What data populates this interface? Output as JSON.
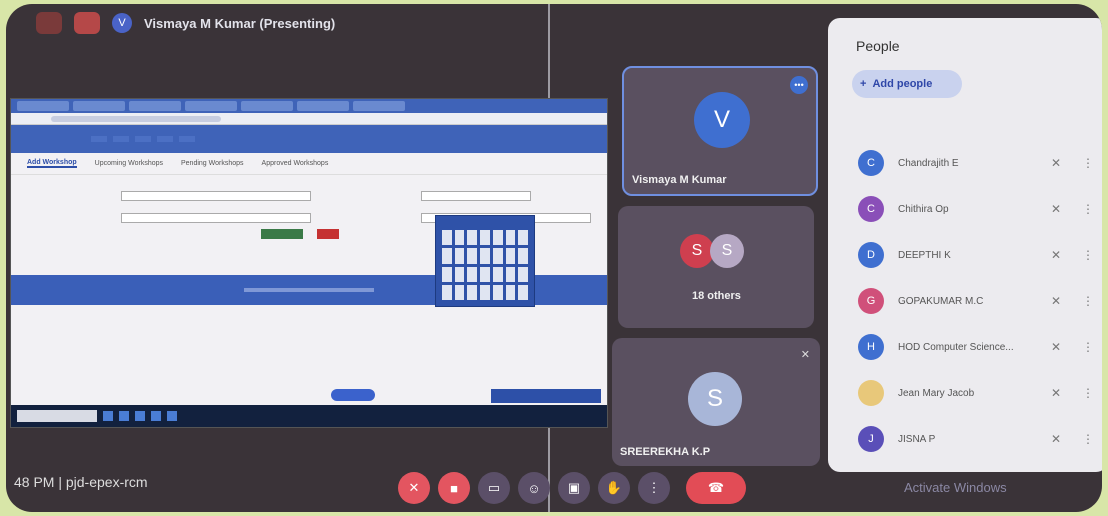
{
  "topbar": {
    "presenter_initial": "V",
    "presenter_text": "Vismaya M Kumar (Presenting)"
  },
  "shared_screen": {
    "sub_tabs": [
      "Add Workshop",
      "Upcoming Workshops",
      "Pending Workshops",
      "Approved Workshops"
    ]
  },
  "tiles": [
    {
      "initial": "V",
      "name": "Vismaya M Kumar",
      "color": "#3f6fd0"
    },
    {
      "initials": [
        "S",
        "S"
      ],
      "name": "18 others",
      "colors": [
        "#cf3f4f",
        "#b6a8c4"
      ]
    },
    {
      "initial": "S",
      "name": "SREEREKHA K.P",
      "color": "#a8b6d8"
    }
  ],
  "people": {
    "title": "People",
    "add_label": "Add people",
    "members": [
      {
        "initial": "C",
        "name": "Chandrajith E",
        "color": "#3f6fd0"
      },
      {
        "initial": "C",
        "name": "Chithira Op",
        "color": "#8a4fb8"
      },
      {
        "initial": "D",
        "name": "DEEPTHI K",
        "color": "#3f6fd0"
      },
      {
        "initial": "G",
        "name": "GOPAKUMAR M.C",
        "color": "#d0507a"
      },
      {
        "initial": "H",
        "name": "HOD Computer Science...",
        "color": "#3f6fd0"
      },
      {
        "initial": "",
        "name": "Jean Mary Jacob",
        "color": "#e8c87a"
      },
      {
        "initial": "J",
        "name": "JISNA P",
        "color": "#5a4fb8"
      }
    ]
  },
  "bottom": {
    "time_code": "48 PM  |  pjd-epex-rcm",
    "activate_text": "Activate Windows"
  }
}
